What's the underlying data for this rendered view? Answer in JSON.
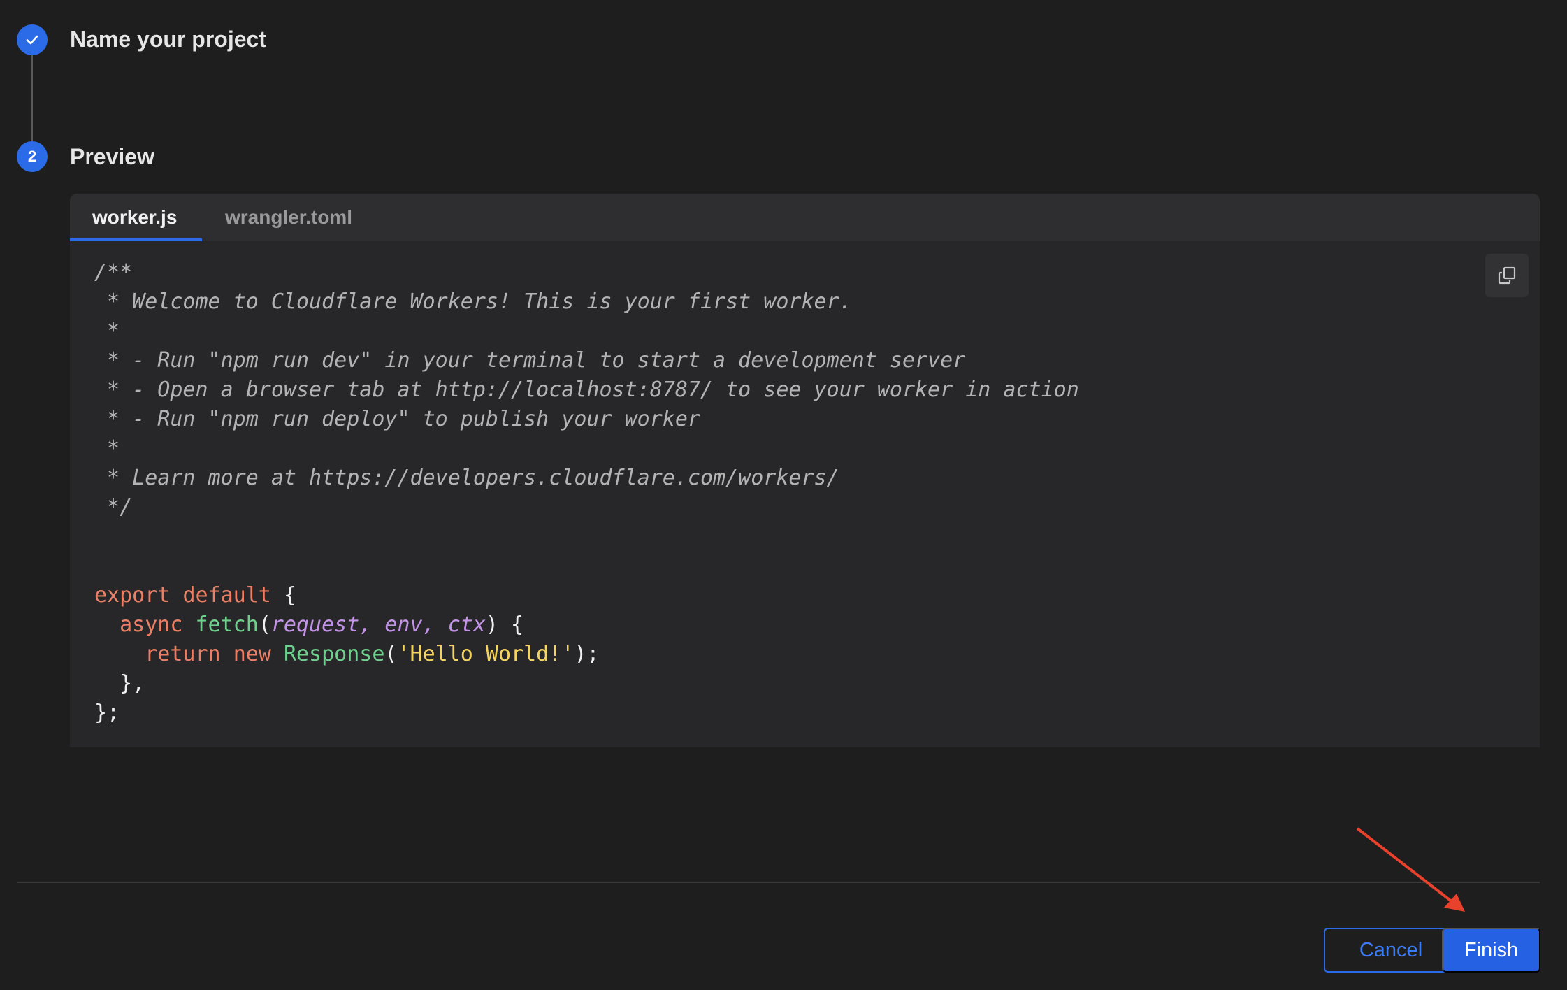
{
  "stepper": {
    "step1": {
      "number": "",
      "title": "Name your project",
      "status": "complete"
    },
    "step2": {
      "number": "2",
      "title": "Preview",
      "status": "active"
    }
  },
  "editor": {
    "tabs": [
      {
        "label": "worker.js",
        "active": true
      },
      {
        "label": "wrangler.toml",
        "active": false
      }
    ],
    "copy_icon": "copy-icon",
    "code_lines": [
      [
        {
          "t": "/**",
          "c": "comment"
        }
      ],
      [
        {
          "t": " * Welcome to Cloudflare Workers! This is your first worker.",
          "c": "comment"
        }
      ],
      [
        {
          "t": " *",
          "c": "comment"
        }
      ],
      [
        {
          "t": " * - Run \"npm run dev\" in your terminal to start a development server",
          "c": "comment"
        }
      ],
      [
        {
          "t": " * - Open a browser tab at http://localhost:8787/ to see your worker in action",
          "c": "comment"
        }
      ],
      [
        {
          "t": " * - Run \"npm run deploy\" to publish your worker",
          "c": "comment"
        }
      ],
      [
        {
          "t": " *",
          "c": "comment"
        }
      ],
      [
        {
          "t": " * Learn more at https://developers.cloudflare.com/workers/",
          "c": "comment"
        }
      ],
      [
        {
          "t": " */",
          "c": "comment"
        }
      ],
      [],
      [],
      [
        {
          "t": "export",
          "c": "kw"
        },
        {
          "t": " ",
          "c": "punct"
        },
        {
          "t": "default",
          "c": "kw"
        },
        {
          "t": " {",
          "c": "punct"
        }
      ],
      [
        {
          "t": "  ",
          "c": "punct"
        },
        {
          "t": "async",
          "c": "kw"
        },
        {
          "t": " ",
          "c": "punct"
        },
        {
          "t": "fetch",
          "c": "fn"
        },
        {
          "t": "(",
          "c": "punct"
        },
        {
          "t": "request, env, ctx",
          "c": "param"
        },
        {
          "t": ") {",
          "c": "punct"
        }
      ],
      [
        {
          "t": "    ",
          "c": "punct"
        },
        {
          "t": "return",
          "c": "kw"
        },
        {
          "t": " ",
          "c": "punct"
        },
        {
          "t": "new",
          "c": "kw"
        },
        {
          "t": " ",
          "c": "punct"
        },
        {
          "t": "Response",
          "c": "fn"
        },
        {
          "t": "(",
          "c": "punct"
        },
        {
          "t": "'Hello World!'",
          "c": "str"
        },
        {
          "t": ");",
          "c": "punct"
        }
      ],
      [
        {
          "t": "  },",
          "c": "punct"
        }
      ],
      [
        {
          "t": "};",
          "c": "punct"
        }
      ]
    ]
  },
  "footer": {
    "cancel_label": "Cancel",
    "finish_label": "Finish"
  },
  "colors": {
    "accent": "#2c6be8",
    "annotation_arrow": "#e8412c"
  }
}
